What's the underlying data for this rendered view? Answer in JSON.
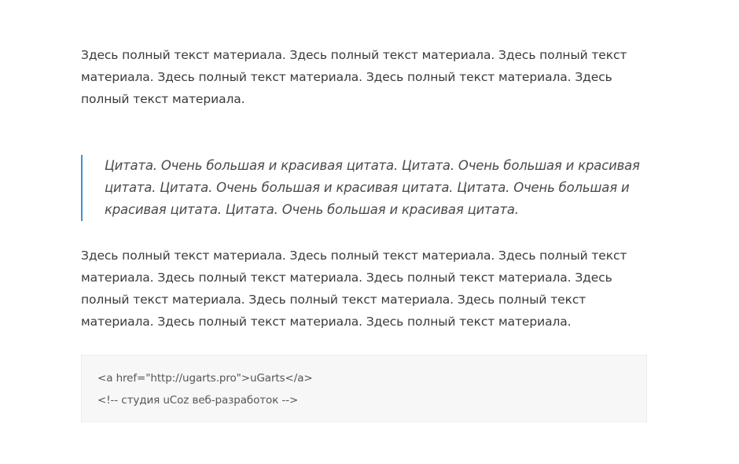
{
  "article": {
    "paragraph_1": "Здесь полный текст материала. Здесь полный текст материала. Здесь полный текст материала. Здесь полный текст материала. Здесь полный текст материала. Здесь полный текст материала.",
    "quote": "Цитата. Очень большая и красивая цитата. Цитата. Очень большая и красивая цитата. Цитата. Очень большая и красивая цитата. Цитата. Очень большая и красивая цитата. Цитата. Очень большая и красивая цитата.",
    "paragraph_2": "Здесь полный текст материала. Здесь полный текст материала. Здесь полный текст материала. Здесь полный текст материала. Здесь полный текст материала. Здесь полный текст материала. Здесь полный текст материала. Здесь полный текст материала. Здесь полный текст материала. Здесь полный текст материала.",
    "code": {
      "line_1": "<a href=\"http://ugarts.pro\">uGarts</a>",
      "line_2": "<!-- студия uCoz веб-разработок -->"
    }
  },
  "colors": {
    "text": "#3a3a3a",
    "quote_border": "#3f8fd0",
    "code_background": "#f7f7f7"
  }
}
